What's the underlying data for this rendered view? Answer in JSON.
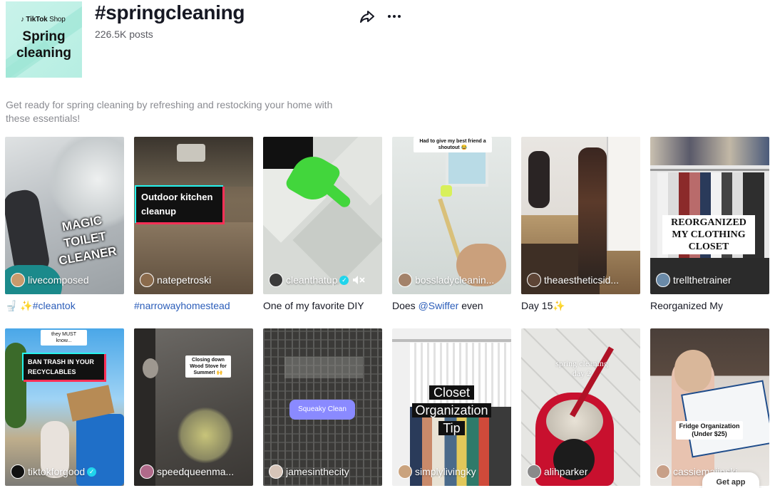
{
  "header": {
    "cover": {
      "brand": "TikTok",
      "brand_suffix": "Shop",
      "title_line1": "Spring",
      "title_line2": "cleaning"
    },
    "hashtag": "#springcleaning",
    "posts": "226.5K posts",
    "description": "Get ready for spring cleaning by refreshing and restocking your home with these essentials!"
  },
  "videos": [
    {
      "user": "livecomposed",
      "caption_prefix": "🚽 ✨",
      "caption_link": "#cleantok",
      "caption_suffix": "",
      "overlay": "MAGIC\nTOILET\nCLEANER"
    },
    {
      "user": "natepetroski",
      "caption_prefix": "",
      "caption_link": "#narrowayhomestead",
      "caption_suffix": "",
      "overlay": "Outdoor kitchen\ncleanup"
    },
    {
      "user": "cleanthatup",
      "verified": true,
      "caption_prefix": "One of my favorite DIY",
      "caption_link": "",
      "caption_suffix": ""
    },
    {
      "user": "bossladycleanin...",
      "caption_prefix": "Does ",
      "caption_link": "@Swiffer",
      "caption_suffix": " even",
      "overlay": "Had to give my best friend a\nshoutout 😂"
    },
    {
      "user": "theaestheticsid...",
      "caption_prefix": "Day 15✨",
      "caption_link": "",
      "caption_suffix": ""
    },
    {
      "user": "trellthetrainer",
      "caption_prefix": "Reorganized My",
      "caption_link": "",
      "caption_suffix": "",
      "overlay": "REORGANIZED\nMY CLOTHING\nCLOSET"
    },
    {
      "user": "tiktokforgood",
      "verified": true,
      "overlay": "BAN TRASH IN YOUR\nRECYCLABLES",
      "overlay_top": "they MUST know..."
    },
    {
      "user": "speedqueenma...",
      "overlay": "Closing down\nWood Stove for\nSummer! 🙌"
    },
    {
      "user": "jamesinthecity",
      "overlay": "Squeaky Clean"
    },
    {
      "user": "simplylivingky",
      "overlay": "Closet\nOrganization\nTip"
    },
    {
      "user": "alihparker",
      "overlay": "spring cleaning\nday 2"
    },
    {
      "user": "cassiemajinski",
      "overlay": "Fridge Organization\n(Under $25)"
    }
  ],
  "get_app": "Get app",
  "colors": {
    "link": "#2b5db9",
    "verified": "#20d5ec",
    "cover_bg": "#c9f3ea"
  },
  "icons": {
    "share": "share-arrow-icon",
    "more": "ellipsis-icon",
    "mute": "speaker-muted-icon"
  }
}
